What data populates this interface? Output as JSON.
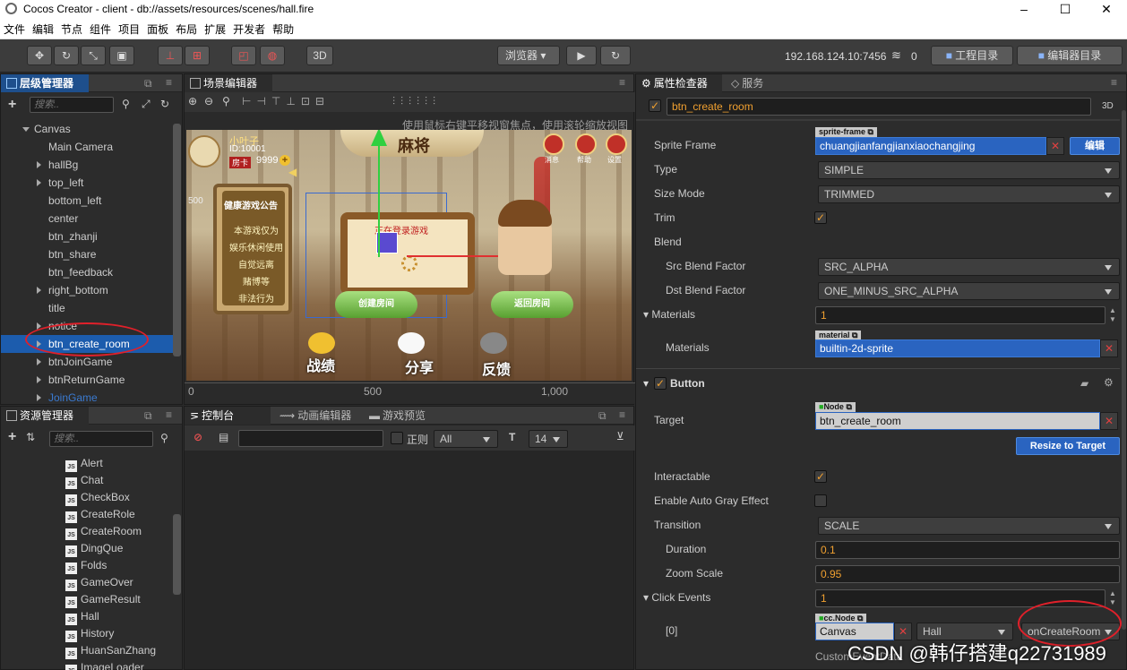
{
  "window": {
    "title": "Cocos Creator - client - db://assets/resources/scenes/hall.fire",
    "minimize": "–",
    "maximize": "☐",
    "close": "✕"
  },
  "menu": [
    "文件",
    "编辑",
    "节点",
    "组件",
    "项目",
    "面板",
    "布局",
    "扩展",
    "开发者",
    "帮助"
  ],
  "toolbar": {
    "btn3d": "3D",
    "browser": "浏览器",
    "ip": "192.168.124.10:7456",
    "wifi_count": "0",
    "project_dir": "工程目录",
    "editor_dir": "编辑器目录"
  },
  "hierarchy": {
    "tab": "层级管理器",
    "search_placeholder": "搜索..",
    "items": [
      {
        "label": "Canvas",
        "level": 0,
        "arrow": "down"
      },
      {
        "label": "Main Camera",
        "level": 1,
        "arrow": "none"
      },
      {
        "label": "hallBg",
        "level": 1,
        "arrow": "right"
      },
      {
        "label": "top_left",
        "level": 1,
        "arrow": "right"
      },
      {
        "label": "bottom_left",
        "level": 1,
        "arrow": "none"
      },
      {
        "label": "center",
        "level": 1,
        "arrow": "none"
      },
      {
        "label": "btn_zhanji",
        "level": 1,
        "arrow": "none"
      },
      {
        "label": "btn_share",
        "level": 1,
        "arrow": "none"
      },
      {
        "label": "btn_feedback",
        "level": 1,
        "arrow": "none"
      },
      {
        "label": "right_bottom",
        "level": 1,
        "arrow": "right"
      },
      {
        "label": "title",
        "level": 1,
        "arrow": "none"
      },
      {
        "label": "notice",
        "level": 1,
        "arrow": "right"
      },
      {
        "label": "btn_create_room",
        "level": 1,
        "arrow": "right",
        "selected": true
      },
      {
        "label": "btnJoinGame",
        "level": 1,
        "arrow": "right"
      },
      {
        "label": "btnReturnGame",
        "level": 1,
        "arrow": "right"
      },
      {
        "label": "JoinGame",
        "level": 1,
        "arrow": "right",
        "dim": true
      }
    ]
  },
  "scene": {
    "tab": "场景编辑器",
    "hint": "使用鼠标右键平移视窗焦点，使用滚轮缩放视图",
    "ruler_marks": [
      "0",
      "500",
      "1,000"
    ],
    "side_mark": "500",
    "game": {
      "username": "小叶子",
      "uid": "ID:10001",
      "card_label": "房卡",
      "cards": "9999",
      "title": "麻将",
      "top_icons": [
        "消息",
        "帮助",
        "设置"
      ],
      "notice_title": "健康游戏公告",
      "notice_lines": [
        "本游戏仅为",
        "娱乐休闲使用",
        "自觉远离",
        "赌博等",
        "非法行为"
      ],
      "board_text": "正在登录游戏",
      "btn_create": "创建房间",
      "btn_return": "返回房间",
      "bottom": [
        "战绩",
        "分享",
        "反馈"
      ]
    }
  },
  "assets": {
    "tab": "资源管理器",
    "search_placeholder": "搜索..",
    "items": [
      "Alert",
      "Chat",
      "CheckBox",
      "CreateRole",
      "CreateRoom",
      "DingQue",
      "Folds",
      "GameOver",
      "GameResult",
      "Hall",
      "History",
      "HuanSanZhang",
      "ImageLoader"
    ]
  },
  "console": {
    "tabs": [
      "控制台",
      "动画编辑器",
      "游戏预览"
    ],
    "regex_label": "正则",
    "level": "All",
    "font_size": "14"
  },
  "inspector": {
    "tabs": [
      "属性检查器",
      "服务"
    ],
    "node_name": "btn_create_room",
    "btn3d": "3D",
    "sprite_frame_label": "Sprite Frame",
    "sprite_frame_tag": "sprite-frame",
    "sprite_frame_value": "chuangjianfangjianxiaochangjing",
    "edit_btn": "编辑",
    "type_label": "Type",
    "type_value": "SIMPLE",
    "size_mode_label": "Size Mode",
    "size_mode_value": "TRIMMED",
    "trim_label": "Trim",
    "blend_label": "Blend",
    "src_label": "Src Blend Factor",
    "src_value": "SRC_ALPHA",
    "dst_label": "Dst Blend Factor",
    "dst_value": "ONE_MINUS_SRC_ALPHA",
    "materials_label": "Materials",
    "materials_count": "1",
    "materials_item_label": "Materials",
    "material_tag": "material",
    "material_value": "builtin-2d-sprite",
    "button_section": "Button",
    "target_label": "Target",
    "target_tag": "Node",
    "target_value": "btn_create_room",
    "resize_btn": "Resize to Target",
    "interactable_label": "Interactable",
    "auto_gray_label": "Enable Auto Gray Effect",
    "transition_label": "Transition",
    "transition_value": "SCALE",
    "duration_label": "Duration",
    "duration_value": "0.1",
    "zoom_label": "Zoom Scale",
    "zoom_value": "0.95",
    "click_events_label": "Click Events",
    "click_events_count": "1",
    "event0_label": "[0]",
    "event_tag": "cc.Node",
    "event_node": "Canvas",
    "event_component": "Hall",
    "event_handler": "onCreateRoom",
    "custom_label": "CustomEventData"
  },
  "watermark": "CSDN @韩仔搭建q22731989",
  "colors": {
    "selection": "#1c5cad",
    "accent_orange": "#f0a030",
    "annotation_red": "#e0202a",
    "ref_blue": "#2a64c0"
  }
}
